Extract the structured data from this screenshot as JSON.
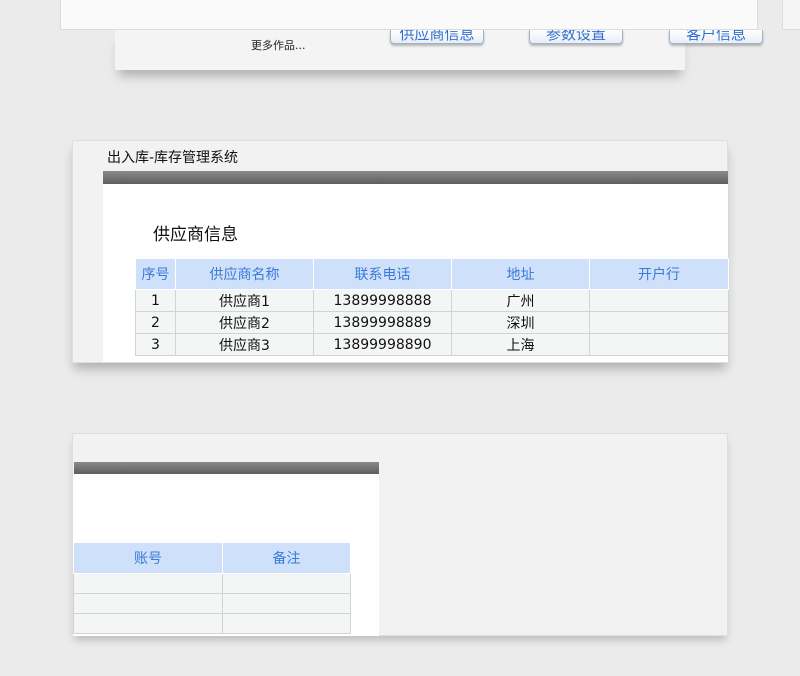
{
  "top": {
    "buttons": [
      "供应商信息",
      "参数设置",
      "客户信息"
    ],
    "more_link": "更多作品..."
  },
  "supplier_window": {
    "title": "出入库-库存管理系统",
    "heading": "供应商信息",
    "columns": [
      "序号",
      "供应商名称",
      "联系电话",
      "地址",
      "开户行"
    ],
    "rows": [
      [
        "1",
        "供应商1",
        "13899998888",
        "广州",
        ""
      ],
      [
        "2",
        "供应商2",
        "13899998889",
        "深圳",
        ""
      ],
      [
        "3",
        "供应商3",
        "13899998890",
        "上海",
        ""
      ]
    ]
  },
  "account_window": {
    "columns": [
      "账号",
      "备注"
    ],
    "rows": [
      [
        "",
        ""
      ],
      [
        "",
        ""
      ],
      [
        "",
        ""
      ]
    ]
  },
  "colors": {
    "header_bg": "#cfe0fb",
    "header_text": "#3a7ad8",
    "bar": "#6e6e6e",
    "page_bg": "#ebebeb"
  }
}
